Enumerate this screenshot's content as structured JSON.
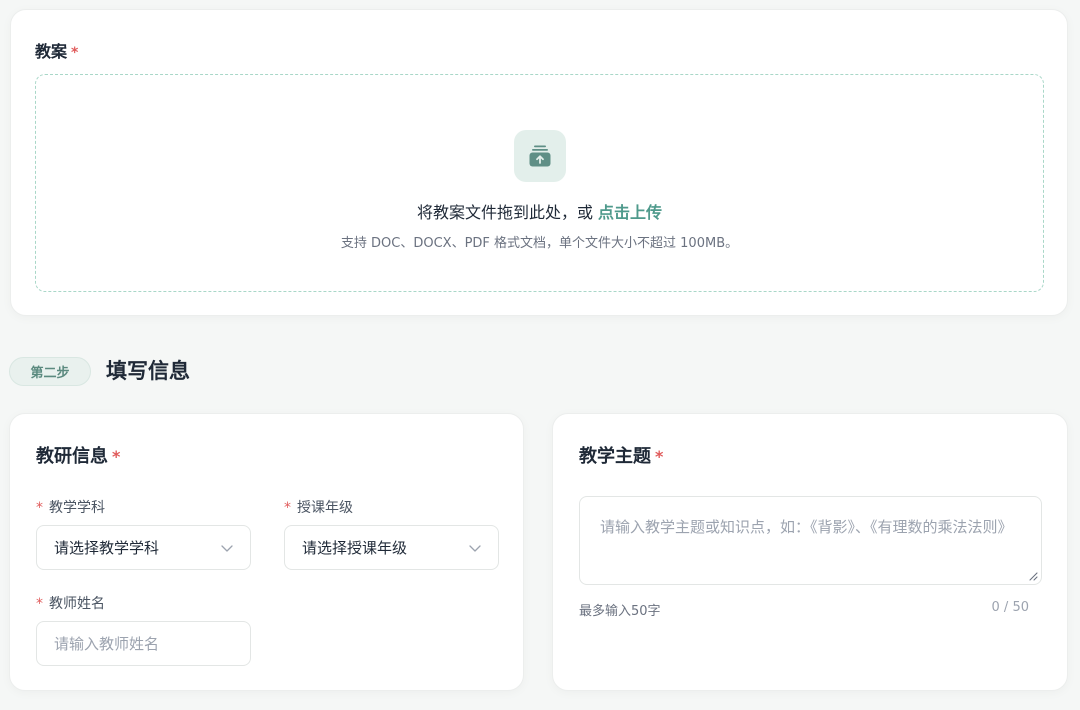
{
  "upload": {
    "title": "教案",
    "required_mark": "*",
    "icon": "upload-tray-icon",
    "drop_text": "将教案文件拖到此处，或",
    "upload_link": "点击上传",
    "hint": "支持 DOC、DOCX、PDF 格式文档，单个文件大小不超过 100MB。"
  },
  "step": {
    "badge": "第二步",
    "title": "填写信息"
  },
  "info_card": {
    "title": "教研信息",
    "required_mark": "*",
    "subject": {
      "label": "教学学科",
      "value": "请选择教学学科"
    },
    "grade": {
      "label": "授课年级",
      "value": "请选择授课年级"
    },
    "teacher": {
      "label": "教师姓名",
      "placeholder": "请输入教师姓名"
    }
  },
  "topic_card": {
    "title": "教学主题",
    "required_mark": "*",
    "placeholder": "请输入教学主题或知识点，如：《背影》、《有理数的乘法法则》",
    "limit_hint": "最多输入50字",
    "counter": "0 / 50"
  },
  "colors": {
    "accent": "#4f9a8c",
    "required": "#e05a5a",
    "dropzone_border": "#a9d7c8",
    "background": "#f5f7f6"
  }
}
